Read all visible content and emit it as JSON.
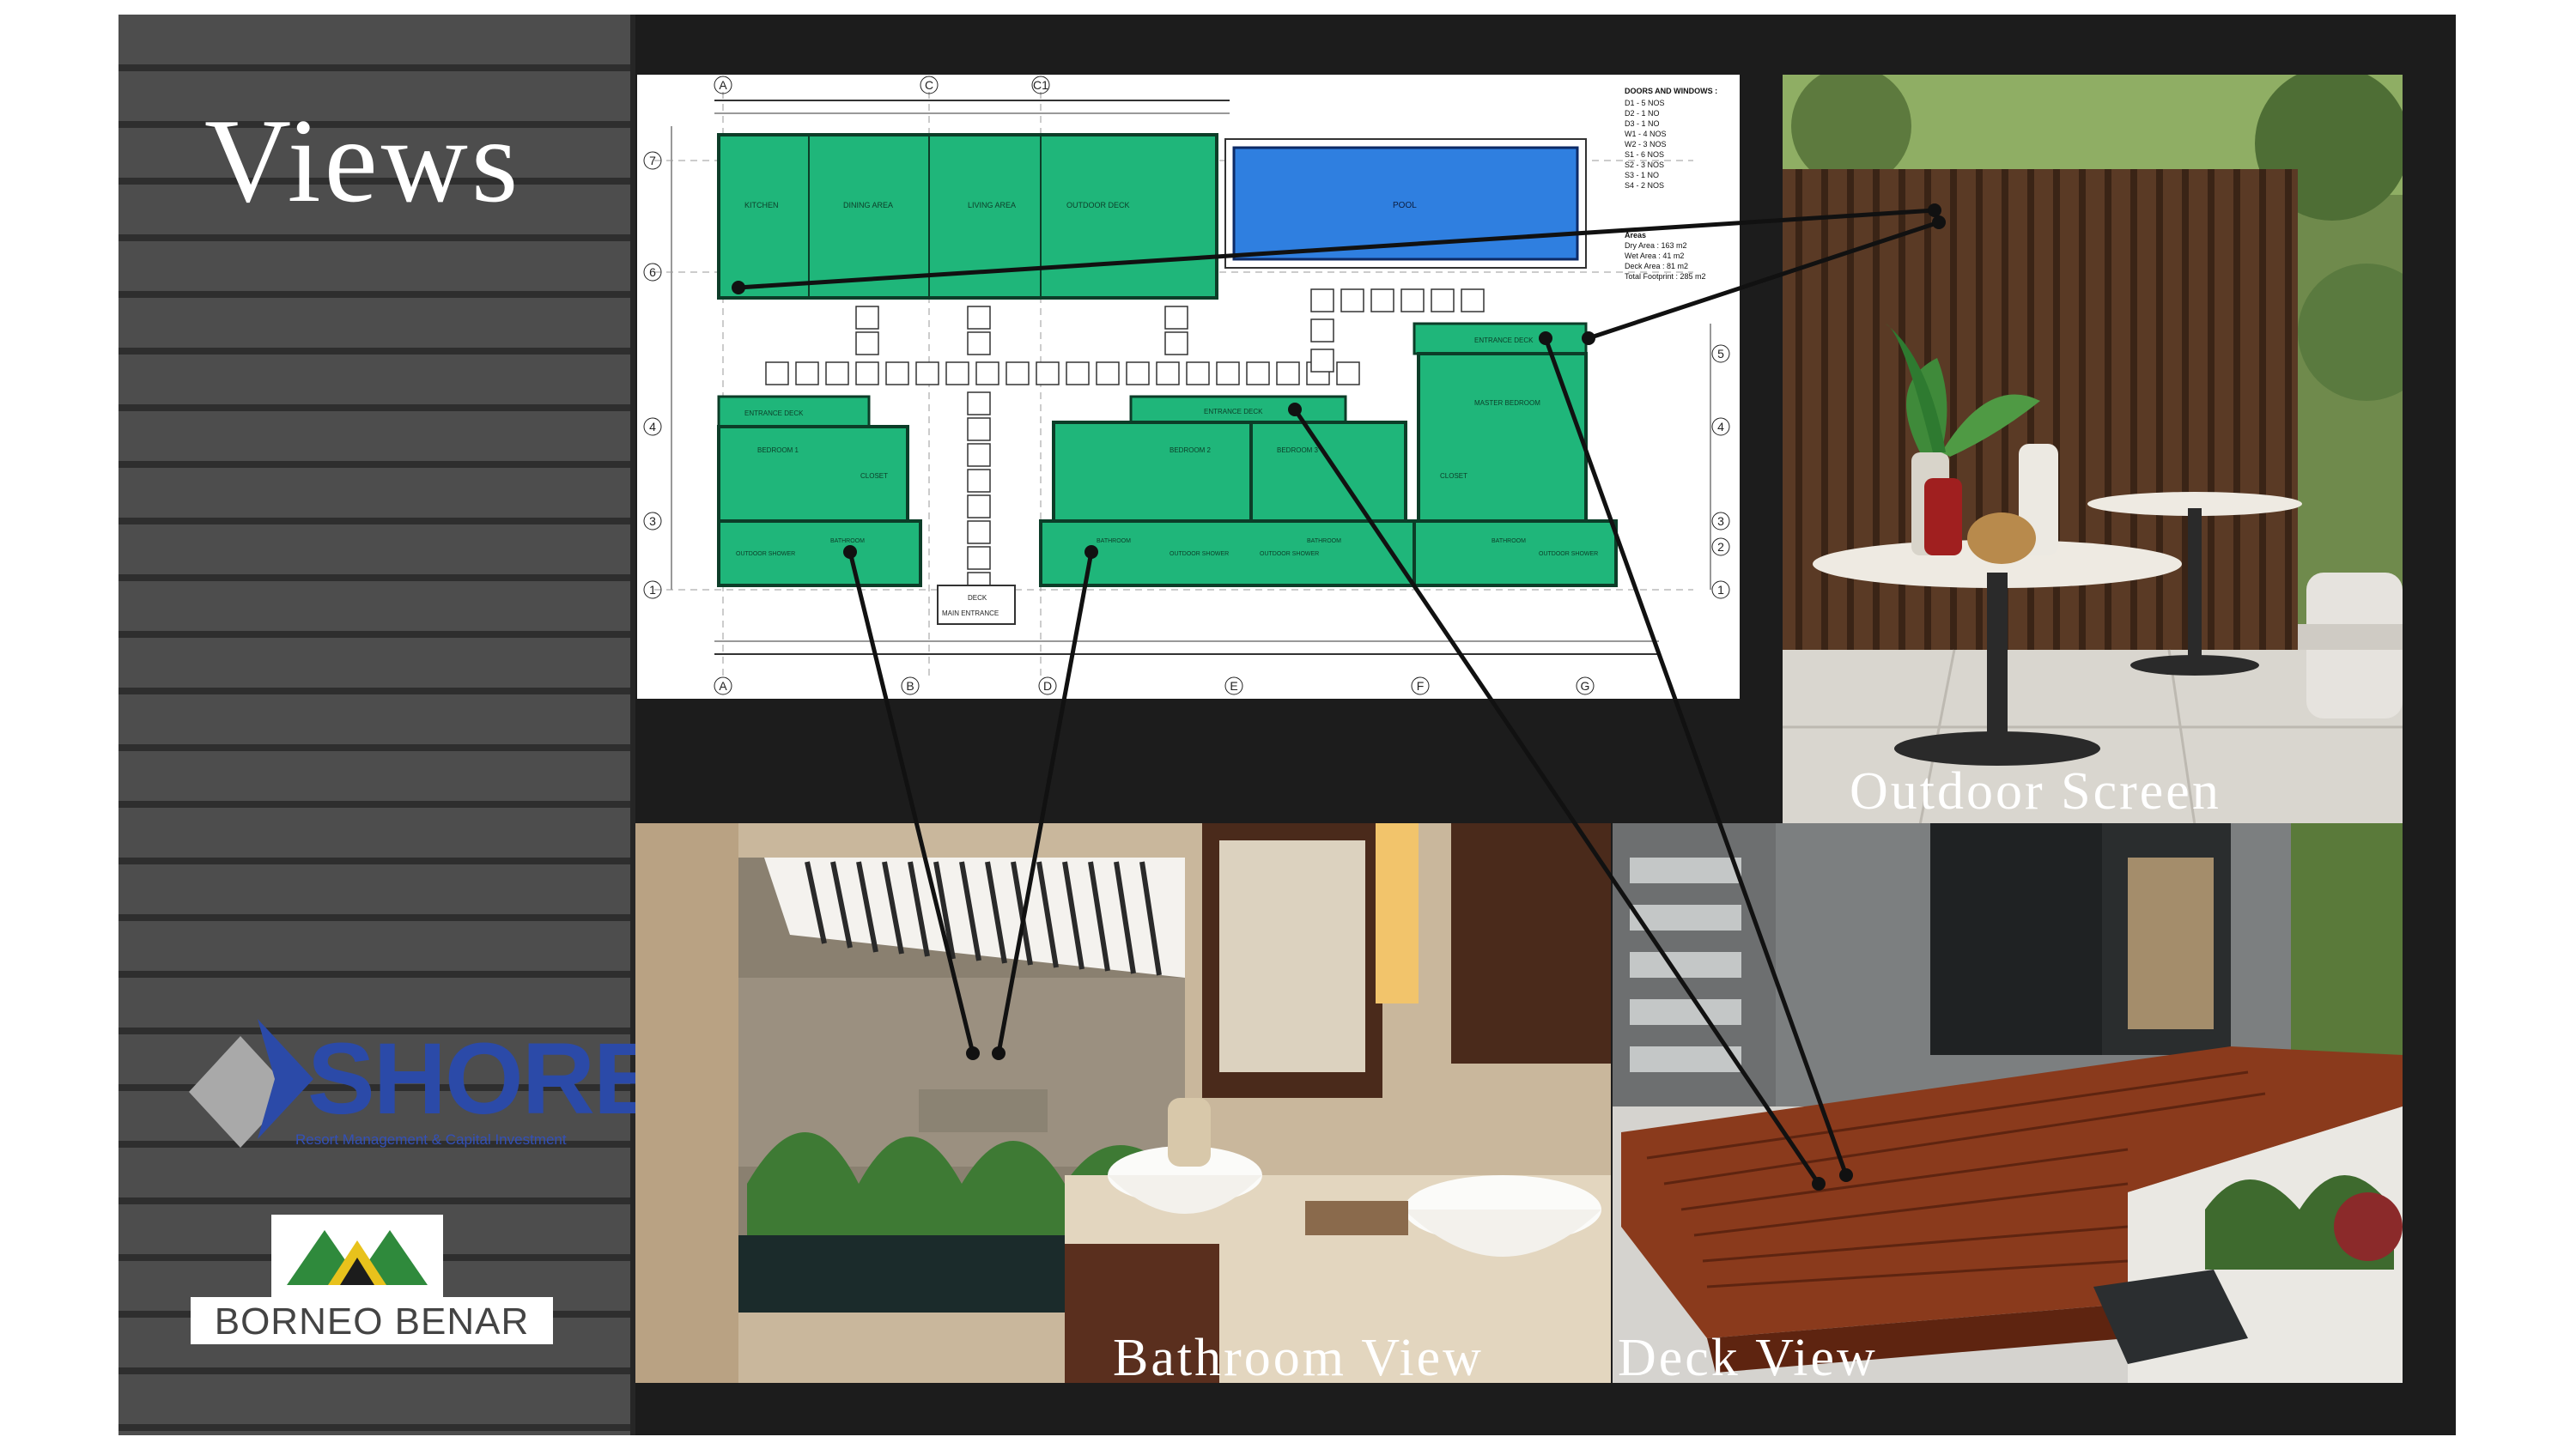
{
  "slide": {
    "title": "Views",
    "captions": {
      "outdoor": "Outdoor Screen",
      "bathroom": "Bathroom View",
      "deck": "Deck View"
    }
  },
  "logos": {
    "shore": {
      "name": "SHORE",
      "tagline": "Resort Management & Capital Investment"
    },
    "borneo": {
      "name": "BORNEO BENAR"
    }
  },
  "floor_plan": {
    "grid_top": [
      "A",
      "C",
      "C1"
    ],
    "grid_bottom": [
      "A",
      "B",
      "D",
      "E",
      "F",
      "G"
    ],
    "grid_left": [
      "7",
      "6",
      "4",
      "3",
      "1"
    ],
    "grid_right": [
      "5",
      "4",
      "3",
      "2",
      "1"
    ],
    "rooms": {
      "kitchen": "KITCHEN",
      "dining": "DINING AREA",
      "living": "LIVING AREA",
      "outdoor_deck": "OUTDOOR DECK",
      "pool": "POOL",
      "entrance_deck": "ENTRANCE DECK",
      "master_bedroom": "MASTER BEDROOM",
      "bedroom_1": "BEDROOM 1",
      "bedroom_2": "BEDROOM 2",
      "bedroom_3": "BEDROOM 3",
      "closet": "CLOSET",
      "bathroom": "BATHROOM",
      "outdoor_shower": "OUTDOOR SHOWER",
      "deck": "DECK",
      "main_entrance": "MAIN ENTRANCE"
    },
    "schedule_title": "DOORS AND WINDOWS :",
    "schedule": [
      "D1 - 5 NOS",
      "D2 - 1 NO",
      "D3 - 1 NO",
      "W1 - 4 NOS",
      "W2 - 3 NOS",
      "S1 - 6 NOS",
      "S2 - 3 NOS",
      "S3 - 1 NO",
      "S4 - 2 NOS"
    ],
    "areas_title": "Areas",
    "areas": [
      "Dry Area : 163 m2",
      "Wet Area : 41 m2",
      "Deck Area : 81 m2",
      "Total Footprint : 285 m2"
    ]
  },
  "colors": {
    "room_green": "#1fb67a",
    "pool_blue": "#2f7fe0",
    "slide_bg": "#1c1c1c",
    "sidebar_stripe": "#4d4d4d",
    "shore_blue": "#2b4aa8",
    "borneo_green": "#2f8a3c"
  }
}
